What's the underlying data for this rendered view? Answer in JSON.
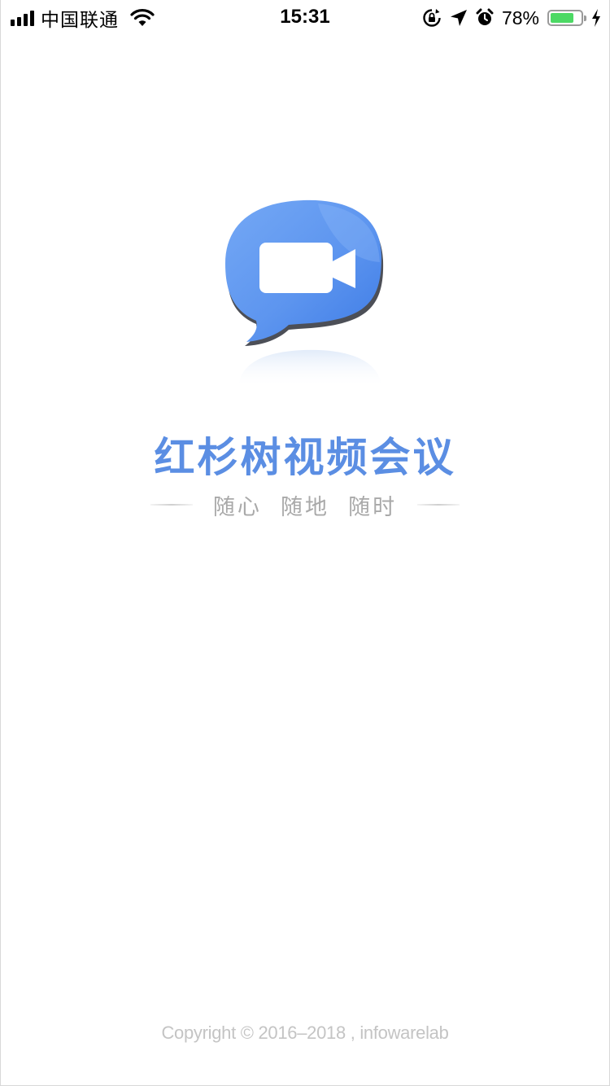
{
  "status_bar": {
    "carrier": "中国联通",
    "time": "15:31",
    "battery_percent": "78%",
    "battery_level": 0.78,
    "icons": [
      "signal-icon",
      "wifi-icon",
      "rotation-lock-icon",
      "location-icon",
      "alarm-icon",
      "battery-icon",
      "charging-icon"
    ]
  },
  "splash": {
    "app_name": "红杉树视频会议",
    "slogan": "随心  随地  随时",
    "logo_icon": "video-chat-bubble-icon",
    "copyright": "Copyright © 2016–2018 , infowarelab"
  },
  "colors": {
    "brand_blue": "#5b8ee3",
    "bubble_light": "#6ea3f3",
    "bubble_dark": "#3f7de8",
    "slogan_gray": "#a9a9a9",
    "copyright_gray": "#c4c4c4",
    "battery_green": "#4cd964"
  }
}
